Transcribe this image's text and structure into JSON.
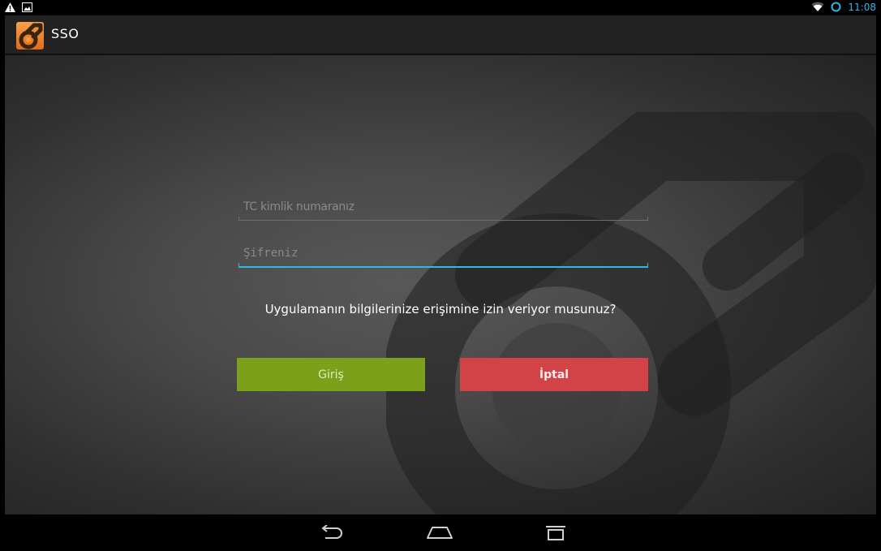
{
  "status_bar": {
    "time": "11:08",
    "icons": [
      "warning-icon",
      "image-notification-icon",
      "wifi-icon",
      "sync-icon"
    ]
  },
  "action_bar": {
    "app_icon": "sso-app-icon",
    "title": "SSO"
  },
  "form": {
    "tc_field": {
      "placeholder": "TC kimlik numaranız",
      "value": ""
    },
    "password_field": {
      "placeholder": "Şifreniz",
      "value": ""
    },
    "question": "Uygulamanın bilgilerinize erişimine izin veriyor musunuz?",
    "login_label": "Giriş",
    "cancel_label": "İptal"
  },
  "nav_bar": {
    "icons": [
      "back-icon",
      "home-icon",
      "recent-apps-icon"
    ]
  },
  "colors": {
    "accent": "#33b5e5",
    "login_button": "#7ba11b",
    "cancel_button": "#d14347",
    "action_bar": "#222222"
  }
}
